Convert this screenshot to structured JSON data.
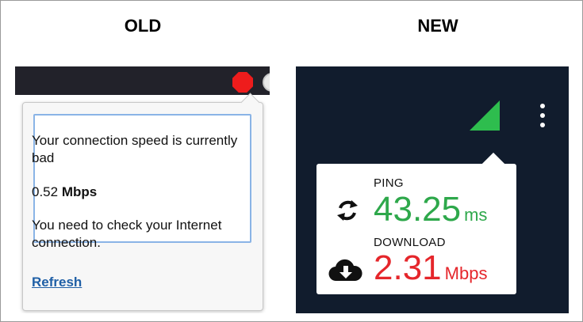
{
  "old": {
    "title": "OLD",
    "message": "Your connection speed is currently bad",
    "speed_value": "0.52",
    "speed_unit": "Mbps",
    "advice": "You need to check your Internet connection.",
    "refresh_label": "Refresh",
    "icons": [
      "stop-icon"
    ]
  },
  "new": {
    "title": "NEW",
    "ping_label": "PING",
    "ping_value": "43.25",
    "ping_unit": "ms",
    "download_label": "DOWNLOAD",
    "download_value": "2.31",
    "download_unit": "Mbps",
    "icons": [
      "signal-icon",
      "menu-icon",
      "refresh-icon",
      "download-cloud-icon"
    ]
  },
  "colors": {
    "old_bar": "#22222a",
    "stop_red": "#ee1c1c",
    "link_blue": "#1f5fa6",
    "new_bg": "#111c2d",
    "signal_green": "#2ebd4e",
    "ping_green": "#2ea84b",
    "download_red": "#e5262b"
  }
}
